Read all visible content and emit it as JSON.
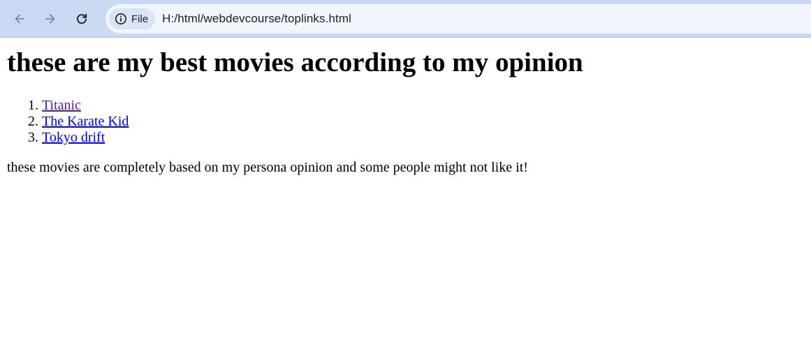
{
  "browser": {
    "back_icon": "arrow-left-icon",
    "forward_icon": "arrow-right-icon",
    "reload_icon": "reload-icon",
    "site_info_icon": "info-icon",
    "site_info_label": "File",
    "url": "H:/html/webdevcourse/toplinks.html"
  },
  "page": {
    "heading": "these are my best movies according to my opinion",
    "movies": [
      {
        "label": "Titanic",
        "visited": true
      },
      {
        "label": "The Karate Kid",
        "visited": false
      },
      {
        "label": "Tokyo drift",
        "visited": false
      }
    ],
    "note": "these movies are completely based on my persona opinion and some people might not like it!"
  },
  "colors": {
    "toolbar_bg": "#c9d9f4",
    "omnibox_bg": "#f1f5fc",
    "link": "#0000ee",
    "visited_link": "#551a8b"
  }
}
